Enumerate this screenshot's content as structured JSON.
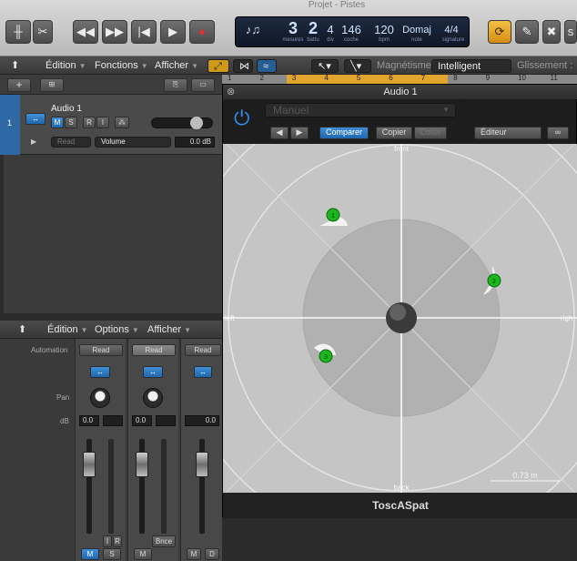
{
  "window": {
    "title": "Projet - Pistes"
  },
  "transport": {
    "measure": "3",
    "beat": "2",
    "division": "4",
    "tick": "146",
    "tempo": "120",
    "key": "Domaj",
    "time_sig": "4/4",
    "labels": {
      "measure": "mesures",
      "beat": "battu",
      "division": "div",
      "tick": "coche",
      "tempo": "bpm",
      "key": "note",
      "signature": "signature"
    }
  },
  "menubar": {
    "edition": "Édition",
    "fonctions": "Fonctions",
    "afficher": "Afficher",
    "magnetisme_label": "Magnétisme :",
    "magnetisme_value": "Intelligent",
    "glissement_label": "Glissement :"
  },
  "ruler": {
    "marks": [
      "1",
      "2",
      "3",
      "4",
      "5",
      "6",
      "7",
      "8",
      "9",
      "10",
      "11"
    ]
  },
  "track": {
    "number": "1",
    "name": "Audio 1",
    "m": "M",
    "s": "S",
    "r": "R",
    "i": "I",
    "read": "Read",
    "volume": "Volume",
    "volume_value": "0.0 dB"
  },
  "mixer_menubar": {
    "edition": "Édition",
    "options": "Options",
    "afficher": "Afficher"
  },
  "mixer": {
    "automation_label": "Automation",
    "pan_label": "Pan",
    "db_label": "dB",
    "strips": [
      {
        "read": "Read",
        "db": "0.0",
        "buttons": [
          "M",
          "S"
        ],
        "extra": [
          "I",
          "R"
        ]
      },
      {
        "read": "Read",
        "db": "0.0",
        "buttons": [
          "M"
        ],
        "extra": [
          "Bnce"
        ]
      },
      {
        "read": "Read",
        "db": "0.0",
        "buttons": [
          "M",
          "D"
        ],
        "extra": []
      }
    ]
  },
  "plugin": {
    "title": "Audio 1",
    "preset": "Manuel",
    "compare": "Comparer",
    "copy": "Copier",
    "paste": "Coller",
    "view": "Éditeur",
    "footer": "ToscASpat",
    "space": {
      "front": "front",
      "back": "back",
      "left": "left",
      "right": "righ",
      "scale": "0.73 m"
    },
    "sources": [
      {
        "id": "1"
      },
      {
        "id": "2"
      },
      {
        "id": "3"
      }
    ]
  },
  "colors": {
    "accent": "#1f67ad",
    "source": "#1db51d",
    "cycle": "#f0a81c"
  }
}
